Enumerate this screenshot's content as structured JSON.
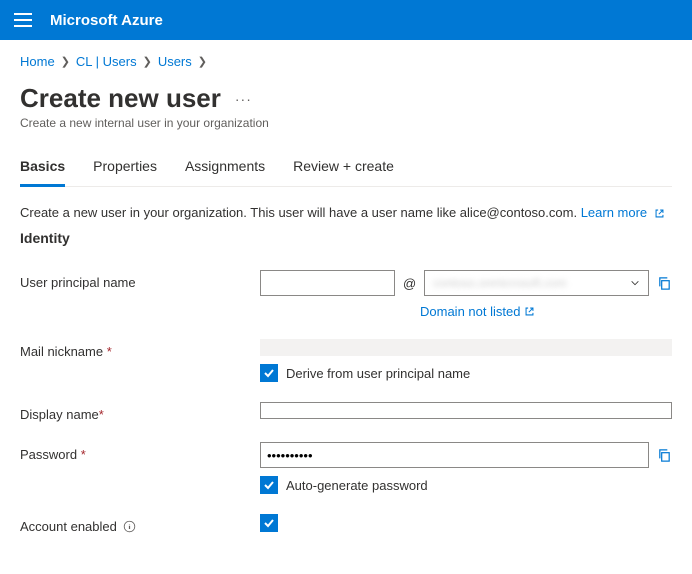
{
  "brand": "Microsoft Azure",
  "breadcrumb": {
    "items": [
      "Home",
      "CL | Users",
      "Users"
    ]
  },
  "page": {
    "title": "Create new user",
    "subtitle": "Create a new internal user in your organization"
  },
  "tabs": {
    "items": [
      {
        "label": "Basics",
        "active": true
      },
      {
        "label": "Properties",
        "active": false
      },
      {
        "label": "Assignments",
        "active": false
      },
      {
        "label": "Review + create",
        "active": false
      }
    ]
  },
  "info": {
    "text": "Create a new user in your organization. This user will have a user name like alice@contoso.com.",
    "learn_more": "Learn more"
  },
  "section": {
    "identity": "Identity"
  },
  "fields": {
    "upn": {
      "label": "User principal name",
      "local_value": "",
      "at": "@",
      "domain_value": "contoso.onmicrosoft.com",
      "domain_not_listed": "Domain not listed"
    },
    "mail_nickname": {
      "label": "Mail nickname",
      "value": "",
      "derive_label": "Derive from user principal name",
      "derive_checked": true
    },
    "display_name": {
      "label": "Display name",
      "value": ""
    },
    "password": {
      "label": "Password",
      "value": "••••••••••",
      "auto_label": "Auto-generate password",
      "auto_checked": true
    },
    "account_enabled": {
      "label": "Account enabled",
      "checked": true
    }
  }
}
